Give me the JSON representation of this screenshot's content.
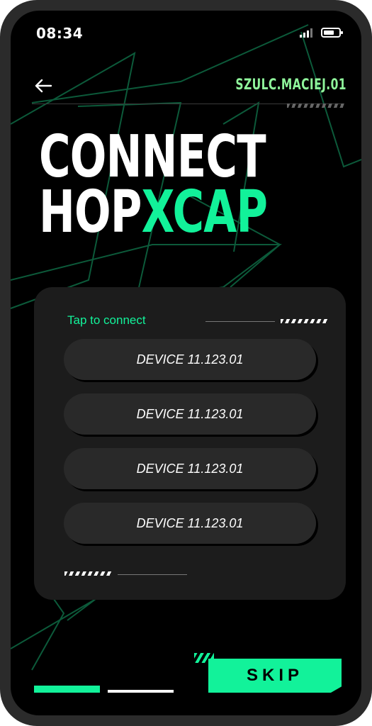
{
  "status_bar": {
    "time": "08:34"
  },
  "header": {
    "username": "SZULC.MACIEJ.01"
  },
  "title": {
    "line1": "CONNECT",
    "line2_plain": "HOP",
    "line2_accent": "XCAP"
  },
  "devices": {
    "prompt": "Tap to connect",
    "items": [
      {
        "label": "DEVICE 11.123.01"
      },
      {
        "label": "DEVICE 11.123.01"
      },
      {
        "label": "DEVICE 11.123.01"
      },
      {
        "label": "DEVICE 11.123.01"
      }
    ]
  },
  "footer": {
    "skip_label": "SKIP",
    "step_current": 1,
    "step_total": 2
  },
  "colors": {
    "accent": "#12f29a",
    "username": "#8ff59b",
    "background": "#000000",
    "card": "#1c1c1c",
    "button": "#292929"
  },
  "icons": {
    "back": "arrow-left-icon",
    "signal": "signal-icon",
    "battery": "battery-icon"
  }
}
